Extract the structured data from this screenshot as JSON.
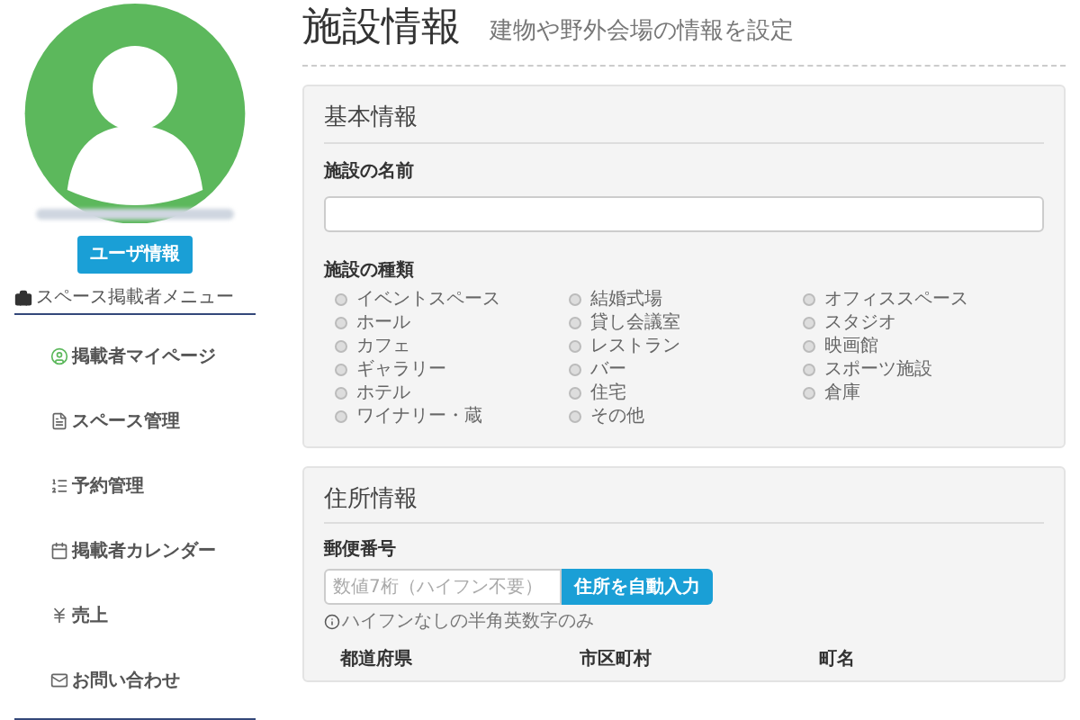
{
  "sidebar": {
    "user_button": "ユーザ情報",
    "menu_title": "スペース掲載者メニュー",
    "items": [
      {
        "label": "掲載者マイページ"
      },
      {
        "label": "スペース管理"
      },
      {
        "label": "予約管理"
      },
      {
        "label": "掲載者カレンダー"
      },
      {
        "label": "売上"
      },
      {
        "label": "お問い合わせ"
      }
    ]
  },
  "page": {
    "title": "施設情報",
    "subtitle": "建物や野外会場の情報を設定"
  },
  "basic_info": {
    "heading": "基本情報",
    "name_label": "施設の名前",
    "type_label": "施設の種類",
    "types": [
      {
        "label": "イベントスペース",
        "selected": false
      },
      {
        "label": "結婚式場",
        "selected": false
      },
      {
        "label": "オフィススペース",
        "selected": false
      },
      {
        "label": "ホール",
        "selected": false
      },
      {
        "label": "貸し会議室",
        "selected": false
      },
      {
        "label": "スタジオ",
        "selected": false
      },
      {
        "label": "カフェ",
        "selected": false
      },
      {
        "label": "レストラン",
        "selected": false
      },
      {
        "label": "映画館",
        "selected": false
      },
      {
        "label": "ギャラリー",
        "selected": false
      },
      {
        "label": "バー",
        "selected": false
      },
      {
        "label": "スポーツ施設",
        "selected": false
      },
      {
        "label": "ホテル",
        "selected": false
      },
      {
        "label": "住宅",
        "selected": false
      },
      {
        "label": "倉庫",
        "selected": false
      },
      {
        "label": "ワイナリー・蔵",
        "selected": false
      },
      {
        "label": "その他",
        "selected": false
      }
    ]
  },
  "address_info": {
    "heading": "住所情報",
    "postal_label": "郵便番号",
    "postal_placeholder": "数値7桁（ハイフン不要）",
    "autofill_button": "住所を自動入力",
    "hint": "ハイフンなしの半角英数字のみ",
    "columns": [
      "都道府県",
      "市区町村",
      "町名"
    ]
  }
}
